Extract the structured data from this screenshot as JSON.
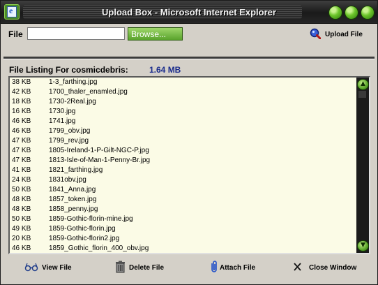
{
  "window": {
    "title": "Upload Box - Microsoft Internet Explorer"
  },
  "upload": {
    "file_label": "File",
    "file_value": "",
    "browse_label": "Browse...",
    "upload_label": "Upload File"
  },
  "listing": {
    "label": "File Listing For cosmicdebris:",
    "total_size": "1.64 MB",
    "files": [
      {
        "size": "38 KB",
        "name": "1-3_farthing.jpg"
      },
      {
        "size": "42 KB",
        "name": "1700_thaler_enamled.jpg"
      },
      {
        "size": "18 KB",
        "name": "1730-2Real.jpg"
      },
      {
        "size": "16 KB",
        "name": "1730.jpg"
      },
      {
        "size": "46 KB",
        "name": "1741.jpg"
      },
      {
        "size": "46 KB",
        "name": "1799_obv.jpg"
      },
      {
        "size": "47 KB",
        "name": "1799_rev.jpg"
      },
      {
        "size": "47 KB",
        "name": "1805-Ireland-1-P-Gilt-NGC-P.jpg"
      },
      {
        "size": "47 KB",
        "name": "1813-Isle-of-Man-1-Penny-Br.jpg"
      },
      {
        "size": "41 KB",
        "name": "1821_farthing.jpg"
      },
      {
        "size": "24 KB",
        "name": "1831obv.jpg"
      },
      {
        "size": "50 KB",
        "name": "1841_Anna.jpg"
      },
      {
        "size": "48 KB",
        "name": "1857_token.jpg"
      },
      {
        "size": "48 KB",
        "name": "1858_penny.jpg"
      },
      {
        "size": "50 KB",
        "name": "1859-Gothic-florin-mine.jpg"
      },
      {
        "size": "49 KB",
        "name": "1859-Gothic-florin.jpg"
      },
      {
        "size": "20 KB",
        "name": "1859-Gothic-florin2.jpg"
      },
      {
        "size": "46 KB",
        "name": "1859_Gothic_florin_400_obv.jpg"
      }
    ]
  },
  "actions": {
    "view_file": "View File",
    "delete_file": "Delete File",
    "attach_file": "Attach File",
    "close_window": "Close Window"
  },
  "colors": {
    "accent_green": "#6cc52a",
    "list_background": "#fbfbe6",
    "size_text": "#1a2c8c"
  }
}
